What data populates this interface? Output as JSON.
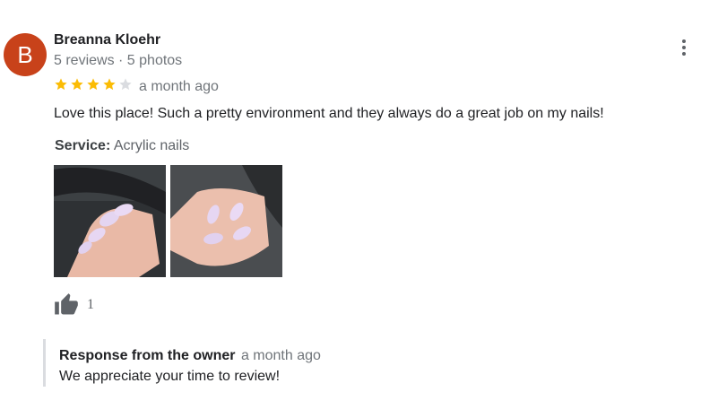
{
  "review": {
    "avatar_letter": "B",
    "author": "Breanna Kloehr",
    "author_meta": "5 reviews · 5 photos",
    "rating": 4,
    "rating_max": 5,
    "date": "a month ago",
    "text": "Love this place! Such a pretty environment and they always do a great job on my nails!",
    "service_label": "Service:",
    "service_value": "Acrylic nails",
    "likes": "1"
  },
  "owner_response": {
    "title": "Response from the owner",
    "date": "a month ago",
    "text": "We appreciate your time to review!"
  },
  "colors": {
    "avatar": "#c8421a",
    "star_filled": "#fbbc04",
    "star_empty": "#dadce0",
    "secondary_text": "#70757a"
  },
  "icons": {
    "more": "more-vert-icon",
    "like": "thumb-up-icon",
    "star": "star-icon"
  }
}
